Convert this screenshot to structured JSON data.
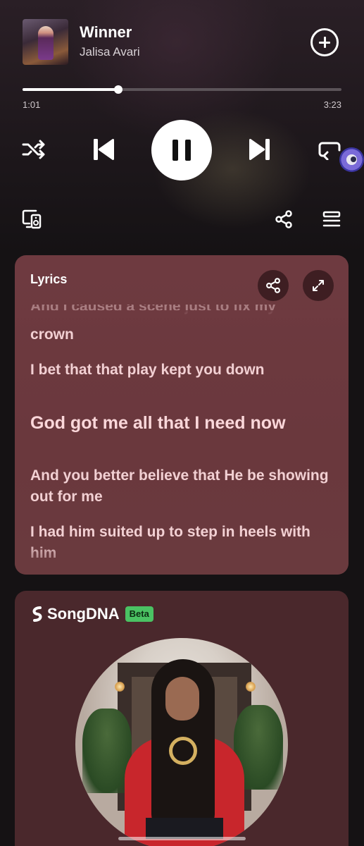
{
  "now_playing": {
    "title": "Winner",
    "artist": "Jalisa Avari",
    "album_art_icon": "album-cover",
    "add_icon": "plus-circle-icon"
  },
  "playback": {
    "elapsed": "1:01",
    "total": "3:23",
    "progress_fraction": 0.3
  },
  "controls": {
    "shuffle_icon": "shuffle-icon",
    "previous_icon": "skip-previous-icon",
    "pause_icon": "pause-icon",
    "next_icon": "skip-next-icon",
    "repeat_icon": "repeat-icon"
  },
  "secondary_controls": {
    "devices_icon": "connect-device-icon",
    "share_icon": "share-icon",
    "queue_icon": "queue-icon"
  },
  "lyrics": {
    "label": "Lyrics",
    "lines": [
      "And I caused a scene just to fix my",
      "crown",
      "I bet that that play kept you down",
      "God got me all that I need now",
      "And you better believe that He be showing out for me",
      "I had him suited up to step in heels with him"
    ],
    "current_line_index": 3
  },
  "song_dna": {
    "name": "SongDNA",
    "badge": "Beta"
  },
  "colors": {
    "background": "#151214",
    "lyrics_card": "#6e3a40",
    "lyrics_text": "#f2d0d3",
    "dna_card": "#4a282c",
    "beta_badge": "#4ac263"
  }
}
